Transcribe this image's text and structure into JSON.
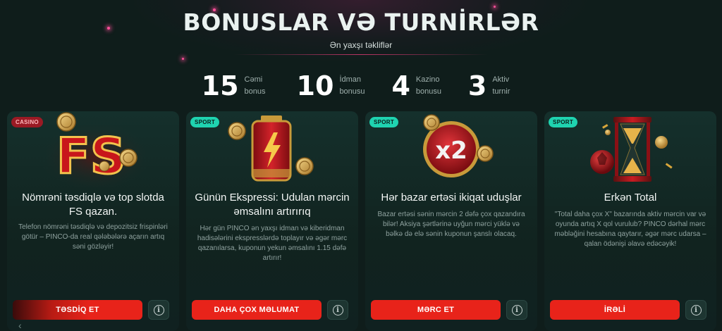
{
  "header": {
    "title": "BONUSLAR VƏ TURNİRLƏR",
    "subtitle": "Ən yaxşı təkliflər"
  },
  "stats": [
    {
      "value": "15",
      "label_line1": "Cəmi",
      "label_line2": "bonus"
    },
    {
      "value": "10",
      "label_line1": "İdman",
      "label_line2": "bonusu"
    },
    {
      "value": "4",
      "label_line1": "Kazino",
      "label_line2": "bonusu"
    },
    {
      "value": "3",
      "label_line1": "Aktiv",
      "label_line2": "turnir"
    }
  ],
  "nav": {
    "prev_icon": "chevron-left-icon",
    "prev_glyph": "‹"
  },
  "cards": [
    {
      "badge": "CASINO",
      "art_text": "FS",
      "title": "Nömrəni təsdiqlə və top slotda FS qazan.",
      "description": "Telefon nömrəni təsdiqlə və depozitsiz frispinləri götür – PINCO-da real qələbələrə açarın artıq səni gözləyir!",
      "button": "TƏSDİQ ET",
      "info_glyph": "i"
    },
    {
      "badge": "SPORT",
      "art_text": "⚡",
      "title": "Günün Ekspressi: Udulan mərcin əmsalını artırırıq",
      "description": "Hər gün PINCO ən yaxşı idman və kiberidman hadisələrini ekspresslərdə toplayır və əgər mərc qazanılarsa, kuponun yekun əmsalını 1.15 dəfə artırır!",
      "button": "DAHA ÇOX MƏLUMAT",
      "info_glyph": "i"
    },
    {
      "badge": "SPORT",
      "art_text": "x2",
      "title": "Hər bazar ertəsi ikiqat uduşlar",
      "description": "Bazar ertəsi sənin mərcin 2 dəfə çox qazandıra bilər! Aksiya şərtlərinə uyğun mərci yüklə və bəlkə də elə sənin kuponun şanslı olacaq.",
      "button": "MƏRC ET",
      "info_glyph": "i"
    },
    {
      "badge": "SPORT",
      "art_text": "",
      "title": "Erkən Total",
      "description": "\"Total daha çox X\" bazarında aktiv mərcin var və oyunda artıq X qol vurulub? PINCO dərhal mərc məbləğini hesabına qaytarır, əgər mərc udarsa – qalan ödənişi əlavə edəcəyik!",
      "button": "İRƏLİ",
      "info_glyph": "i"
    }
  ],
  "colors": {
    "background": "#0f1d1b",
    "accent_red": "#e8231a",
    "sport_badge": "#1fd3b0",
    "casino_badge": "#9a1a24"
  }
}
